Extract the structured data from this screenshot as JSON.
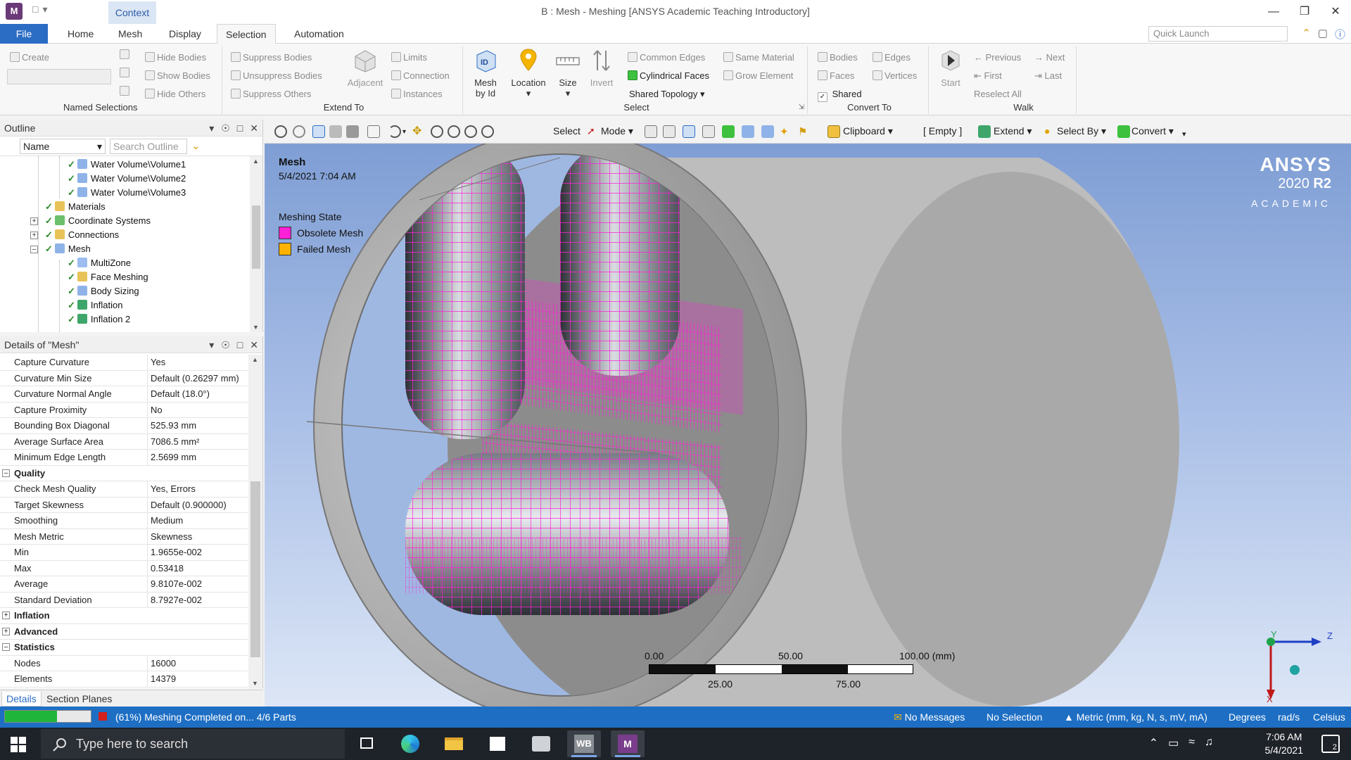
{
  "titlebar": {
    "app_letter": "M",
    "context_tab": "Context",
    "title": "B : Mesh - Meshing [ANSYS Academic Teaching Introductory]"
  },
  "ribbon": {
    "tabs": [
      "File",
      "Home",
      "Mesh",
      "Display",
      "Selection",
      "Automation"
    ],
    "active_tab": "Selection",
    "quick_launch_placeholder": "Quick Launch",
    "named_selections": {
      "create": "Create",
      "hide_bodies": "Hide Bodies",
      "show_bodies": "Show Bodies",
      "hide_others": "Hide Others",
      "label": "Named Selections"
    },
    "extend_to": {
      "suppress_bodies": "Suppress Bodies",
      "unsuppress_bodies": "Unsuppress Bodies",
      "suppress_others": "Suppress Others",
      "adjacent": "Adjacent",
      "limits": "Limits",
      "connection": "Connection",
      "instances": "Instances",
      "label": "Extend To"
    },
    "select": {
      "mesh_by_id_1": "Mesh",
      "mesh_by_id_2": "by Id",
      "location": "Location",
      "size": "Size",
      "invert": "Invert",
      "common_edges": "Common Edges",
      "same_material": "Same Material",
      "cylindrical_faces": "Cylindrical Faces",
      "grow_element": "Grow Element",
      "shared_topology": "Shared Topology",
      "label": "Select"
    },
    "convert_to": {
      "bodies": "Bodies",
      "edges": "Edges",
      "faces": "Faces",
      "vertices": "Vertices",
      "shared": "Shared",
      "label": "Convert To"
    },
    "walk": {
      "start": "Start",
      "previous": "Previous",
      "next": "Next",
      "first": "First",
      "last": "Last",
      "reselect_all": "Reselect All",
      "label": "Walk"
    }
  },
  "outline": {
    "title": "Outline",
    "name_filter": "Name",
    "search_placeholder": "Search Outline",
    "items": [
      "Water Volume\\Volume1",
      "Water Volume\\Volume2",
      "Water Volume\\Volume3",
      "Materials",
      "Coordinate Systems",
      "Connections",
      "Mesh",
      "MultiZone",
      "Face Meshing",
      "Body Sizing",
      "Inflation",
      "Inflation 2"
    ]
  },
  "details": {
    "title": "Details of \"Mesh\"",
    "rows": [
      {
        "k": "Capture Curvature",
        "v": "Yes"
      },
      {
        "k": "Curvature Min Size",
        "v": "Default (0.26297 mm)"
      },
      {
        "k": "Curvature Normal Angle",
        "v": "Default (18.0°)"
      },
      {
        "k": "Capture Proximity",
        "v": "No"
      },
      {
        "k": "Bounding Box Diagonal",
        "v": "525.93 mm"
      },
      {
        "k": "Average Surface Area",
        "v": "7086.5 mm²"
      },
      {
        "k": "Minimum Edge Length",
        "v": "2.5699 mm"
      }
    ],
    "quality_label": "Quality",
    "quality_rows": [
      {
        "k": "Check Mesh Quality",
        "v": "Yes, Errors"
      },
      {
        "k": "Target Skewness",
        "v": "Default (0.900000)"
      },
      {
        "k": "Smoothing",
        "v": "Medium"
      },
      {
        "k": "Mesh Metric",
        "v": "Skewness"
      },
      {
        "k": "Min",
        "v": "1.9655e-002"
      },
      {
        "k": "Max",
        "v": "0.53418"
      },
      {
        "k": "Average",
        "v": "9.8107e-002"
      },
      {
        "k": "Standard Deviation",
        "v": "8.7927e-002"
      }
    ],
    "inflation_label": "Inflation",
    "advanced_label": "Advanced",
    "statistics_label": "Statistics",
    "stat_rows": [
      {
        "k": "Nodes",
        "v": "16000"
      },
      {
        "k": "Elements",
        "v": "14379"
      }
    ]
  },
  "bottom_tabs": {
    "details": "Details",
    "section_planes": "Section Planes"
  },
  "gfx_toolbar": {
    "select": "Select",
    "mode": "Mode",
    "clipboard": "Clipboard",
    "empty": "[ Empty ]",
    "extend": "Extend",
    "select_by": "Select By",
    "convert": "Convert"
  },
  "viewport": {
    "title": "Mesh",
    "date": "5/4/2021 7:04 AM",
    "legend_title": "Meshing State",
    "legend": [
      {
        "label": "Obsolete Mesh",
        "color": "#ff1fd6"
      },
      {
        "label": "Failed Mesh",
        "color": "#ffb300"
      }
    ],
    "logo_1": "ANSYS",
    "logo_2a": "2020",
    "logo_2b": "R2",
    "logo_3": "ACADEMIC",
    "scale": {
      "t0": "0.00",
      "t50": "50.00",
      "t100": "100.00 (mm)",
      "t25": "25.00",
      "t75": "75.00"
    },
    "triad": {
      "y": "Y",
      "z": "Z",
      "x": "X"
    }
  },
  "status": {
    "progress_pct": 0.61,
    "progress_text": "(61%) Meshing Completed on... 4/6 Parts",
    "messages": "No Messages",
    "selection": "No Selection",
    "units": "Metric (mm, kg, N, s, mV, mA)",
    "degrees": "Degrees",
    "rads": "rad/s",
    "temp": "Celsius"
  },
  "taskbar": {
    "search_placeholder": "Type here to search",
    "wb_label": "WB",
    "m_label": "M",
    "time": "7:06 AM",
    "date": "5/4/2021",
    "notif_count": "2"
  },
  "colors": {
    "accent_blue": "#2b6cc4",
    "mesh_magenta": "#ff1fd6",
    "status_bar": "#1e6fc4"
  }
}
